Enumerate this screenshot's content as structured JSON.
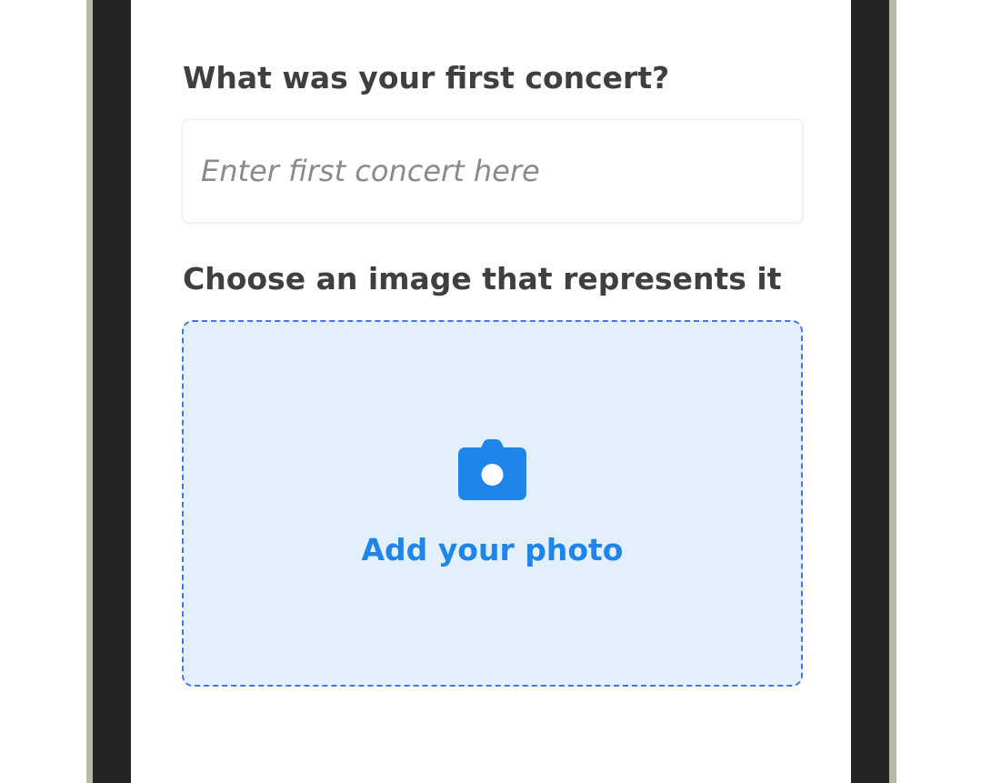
{
  "form": {
    "question_label": "What was your first concert?",
    "concert_input": {
      "value": "",
      "placeholder": "Enter first concert here"
    },
    "image_label": "Choose an image that represents it",
    "upload": {
      "label": "Add your photo",
      "icon": "camera-icon"
    }
  },
  "colors": {
    "accent": "#1e86eb",
    "dropzone_border": "#4a72e6",
    "dropzone_background": "#e3f0fc",
    "label_text": "#3f3f3f",
    "placeholder_text": "#8a8a8a"
  }
}
